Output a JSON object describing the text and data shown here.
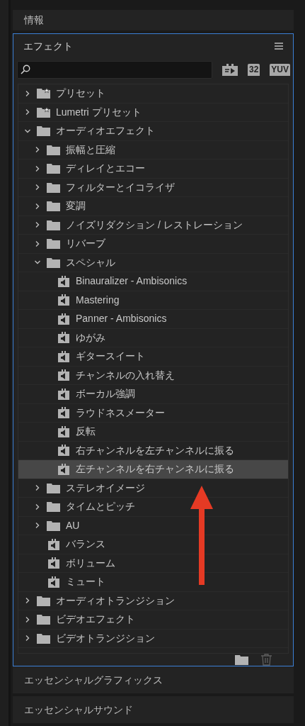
{
  "info_panel": {
    "title": "情報"
  },
  "effects_panel": {
    "title": "エフェクト",
    "filter_badges": [
      {
        "kind": "accelerated"
      },
      {
        "kind": "text",
        "label": "32"
      },
      {
        "kind": "text",
        "label": "YUV"
      }
    ],
    "tree": [
      {
        "kind": "preset-folder",
        "label": "プリセット",
        "expanded": false,
        "selected": false
      },
      {
        "kind": "preset-folder",
        "label": "Lumetri プリセット",
        "expanded": false,
        "selected": false
      },
      {
        "kind": "folder",
        "label": "オーディオエフェクト",
        "expanded": true,
        "selected": false,
        "children": [
          {
            "kind": "folder",
            "label": "振幅と圧縮",
            "expanded": false,
            "selected": false
          },
          {
            "kind": "folder",
            "label": "ディレイとエコー",
            "expanded": false,
            "selected": false
          },
          {
            "kind": "folder",
            "label": "フィルターとイコライザ",
            "expanded": false,
            "selected": false
          },
          {
            "kind": "folder",
            "label": "変調",
            "expanded": false,
            "selected": false
          },
          {
            "kind": "folder",
            "label": "ノイズリダクション / レストレーション",
            "expanded": false,
            "selected": false
          },
          {
            "kind": "folder",
            "label": "リバーブ",
            "expanded": false,
            "selected": false
          },
          {
            "kind": "folder",
            "label": "スペシャル",
            "expanded": true,
            "selected": false,
            "children": [
              {
                "kind": "effect",
                "label": "Binauralizer - Ambisonics",
                "selected": false
              },
              {
                "kind": "effect",
                "label": "Mastering",
                "selected": false
              },
              {
                "kind": "effect",
                "label": "Panner - Ambisonics",
                "selected": false
              },
              {
                "kind": "effect",
                "label": "ゆがみ",
                "selected": false
              },
              {
                "kind": "effect",
                "label": "ギタースイート",
                "selected": false
              },
              {
                "kind": "effect",
                "label": "チャンネルの入れ替え",
                "selected": false
              },
              {
                "kind": "effect",
                "label": "ボーカル強調",
                "selected": false
              },
              {
                "kind": "effect",
                "label": "ラウドネスメーター",
                "selected": false
              },
              {
                "kind": "effect",
                "label": "反転",
                "selected": false
              },
              {
                "kind": "effect",
                "label": "右チャンネルを左チャンネルに振る",
                "selected": false
              },
              {
                "kind": "effect",
                "label": "左チャンネルを右チャンネルに振る",
                "selected": true
              }
            ]
          },
          {
            "kind": "folder",
            "label": "ステレオイメージ",
            "expanded": false,
            "selected": false
          },
          {
            "kind": "folder",
            "label": "タイムとピッチ",
            "expanded": false,
            "selected": false
          },
          {
            "kind": "folder",
            "label": "AU",
            "expanded": false,
            "selected": false
          },
          {
            "kind": "effect",
            "label": "バランス",
            "selected": false
          },
          {
            "kind": "effect",
            "label": "ボリューム",
            "selected": false
          },
          {
            "kind": "effect",
            "label": "ミュート",
            "selected": false
          }
        ]
      },
      {
        "kind": "folder",
        "label": "オーディオトランジション",
        "expanded": false,
        "selected": false
      },
      {
        "kind": "folder",
        "label": "ビデオエフェクト",
        "expanded": false,
        "selected": false
      },
      {
        "kind": "folder",
        "label": "ビデオトランジション",
        "expanded": false,
        "selected": false
      }
    ]
  },
  "lower_panels": [
    {
      "title": "エッセンシャルグラフィックス"
    },
    {
      "title": "エッセンシャルサウンド"
    }
  ]
}
